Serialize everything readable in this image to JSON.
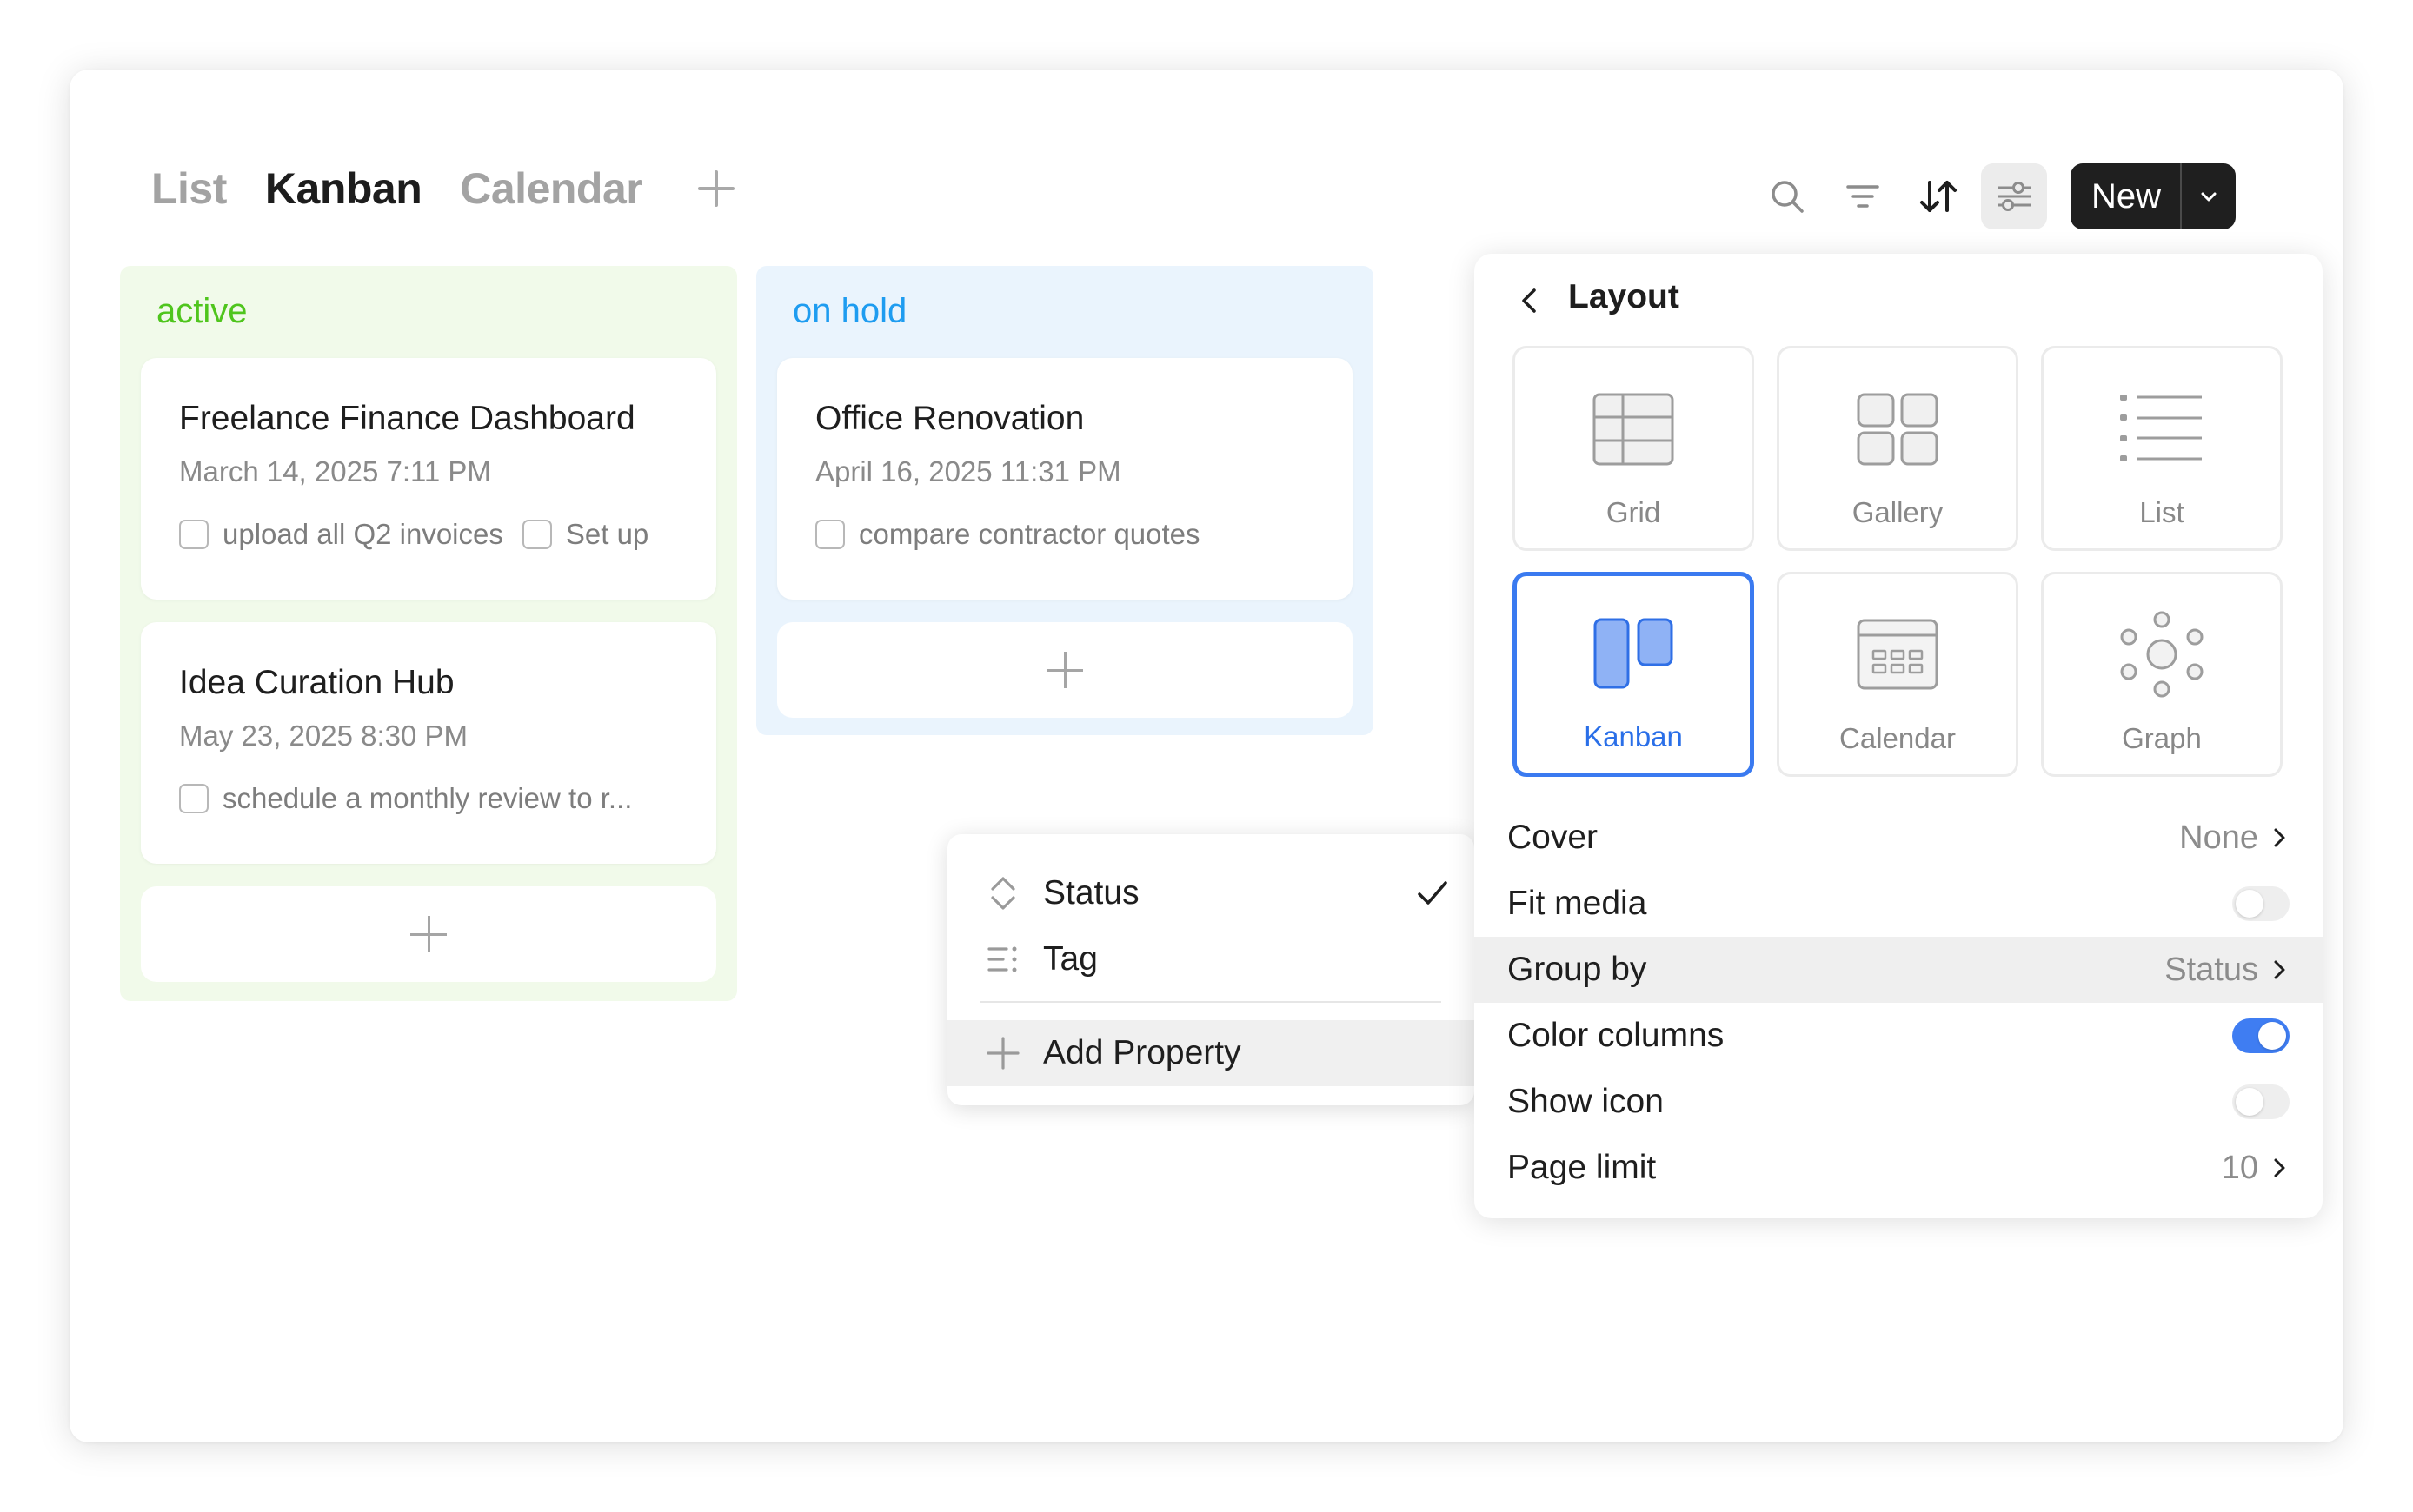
{
  "tabs": [
    {
      "label": "List",
      "active": false
    },
    {
      "label": "Kanban",
      "active": true
    },
    {
      "label": "Calendar",
      "active": false
    }
  ],
  "toolbar": {
    "icons": [
      "search-icon",
      "filter-icon",
      "sort-icon",
      "settings-sliders-icon"
    ],
    "new_label": "New"
  },
  "columns": [
    {
      "title": "active",
      "color": "#4fc51d",
      "background": "#f1faea",
      "cards": [
        {
          "title": "Freelance Finance Dashboard",
          "date": "March 14, 2025 7:11 PM",
          "tasks": [
            "upload all Q2 invoices",
            "Set up"
          ]
        },
        {
          "title": "Idea Curation Hub",
          "date": "May 23, 2025 8:30 PM",
          "tasks": [
            "schedule a monthly review to r..."
          ]
        }
      ]
    },
    {
      "title": "on hold",
      "color": "#1e9cf0",
      "background": "#eaf4fd",
      "cards": [
        {
          "title": "Office Renovation",
          "date": "April 16, 2025 11:31 PM",
          "tasks": [
            "compare contractor quotes"
          ]
        }
      ]
    }
  ],
  "group_menu": {
    "items": [
      {
        "label": "Status",
        "icon": "up-down-chevron-icon",
        "checked": true
      },
      {
        "label": "Tag",
        "icon": "list-icon",
        "checked": false
      }
    ],
    "add_label": "Add Property"
  },
  "layout_panel": {
    "title": "Layout",
    "layouts": [
      {
        "label": "Grid",
        "icon": "grid-icon",
        "selected": false
      },
      {
        "label": "Gallery",
        "icon": "gallery-icon",
        "selected": false
      },
      {
        "label": "List",
        "icon": "list-layout-icon",
        "selected": false
      },
      {
        "label": "Kanban",
        "icon": "kanban-icon",
        "selected": true
      },
      {
        "label": "Calendar",
        "icon": "calendar-icon",
        "selected": false
      },
      {
        "label": "Graph",
        "icon": "graph-icon",
        "selected": false
      }
    ],
    "settings": {
      "cover": {
        "label": "Cover",
        "value": "None"
      },
      "fit_media": {
        "label": "Fit media",
        "on": false
      },
      "group_by": {
        "label": "Group by",
        "value": "Status"
      },
      "color_columns": {
        "label": "Color columns",
        "on": true
      },
      "show_icon": {
        "label": "Show icon",
        "on": false
      },
      "page_limit": {
        "label": "Page limit",
        "value": "10"
      }
    }
  },
  "colors": {
    "accent": "#3a7af0",
    "primary_button": "#1f1f1f"
  }
}
